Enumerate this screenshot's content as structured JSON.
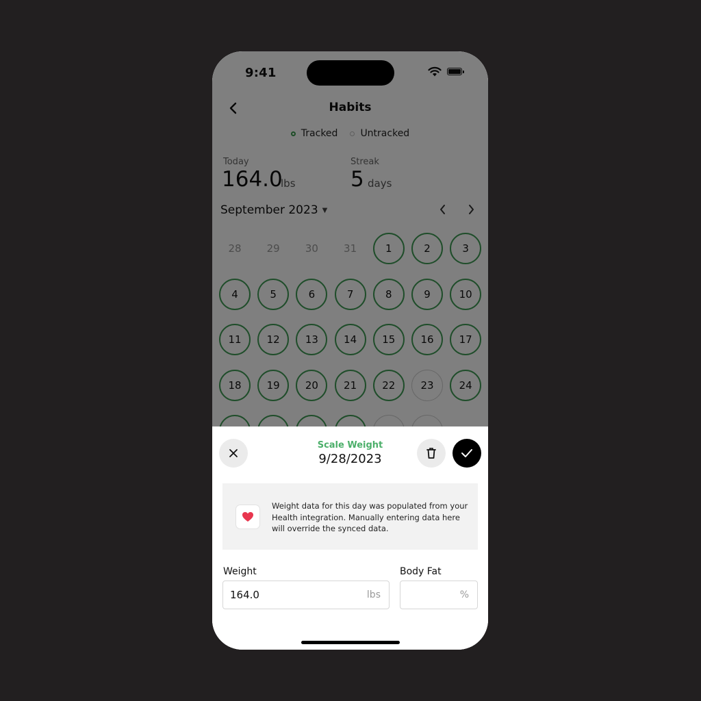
{
  "status_bar": {
    "time": "9:41"
  },
  "header": {
    "title": "Habits"
  },
  "legend": {
    "tracked": "Tracked",
    "untracked": "Untracked"
  },
  "stats": {
    "today": {
      "label": "Today",
      "value": "164.0",
      "unit": "lbs"
    },
    "streak": {
      "label": "Streak",
      "value": "5",
      "unit": "days"
    }
  },
  "calendar": {
    "month": "September 2023",
    "days": [
      {
        "label": "28",
        "state": "outside"
      },
      {
        "label": "29",
        "state": "outside"
      },
      {
        "label": "30",
        "state": "outside"
      },
      {
        "label": "31",
        "state": "outside"
      },
      {
        "label": "1",
        "state": "tracked"
      },
      {
        "label": "2",
        "state": "tracked"
      },
      {
        "label": "3",
        "state": "tracked"
      },
      {
        "label": "4",
        "state": "tracked"
      },
      {
        "label": "5",
        "state": "tracked"
      },
      {
        "label": "6",
        "state": "tracked"
      },
      {
        "label": "7",
        "state": "tracked"
      },
      {
        "label": "8",
        "state": "tracked"
      },
      {
        "label": "9",
        "state": "tracked"
      },
      {
        "label": "10",
        "state": "tracked"
      },
      {
        "label": "11",
        "state": "tracked"
      },
      {
        "label": "12",
        "state": "tracked"
      },
      {
        "label": "13",
        "state": "tracked"
      },
      {
        "label": "14",
        "state": "tracked"
      },
      {
        "label": "15",
        "state": "tracked"
      },
      {
        "label": "16",
        "state": "tracked"
      },
      {
        "label": "17",
        "state": "tracked"
      },
      {
        "label": "18",
        "state": "tracked"
      },
      {
        "label": "19",
        "state": "tracked"
      },
      {
        "label": "20",
        "state": "tracked"
      },
      {
        "label": "21",
        "state": "tracked"
      },
      {
        "label": "22",
        "state": "tracked"
      },
      {
        "label": "23",
        "state": "untracked"
      },
      {
        "label": "24",
        "state": "tracked"
      },
      {
        "label": "",
        "state": "tracked"
      },
      {
        "label": "",
        "state": "tracked"
      },
      {
        "label": "",
        "state": "tracked"
      },
      {
        "label": "",
        "state": "tracked"
      },
      {
        "label": "",
        "state": "untracked"
      },
      {
        "label": "",
        "state": "untracked"
      }
    ]
  },
  "sheet": {
    "subtitle": "Scale Weight",
    "date": "9/28/2023",
    "info": "Weight data for this day was populated from your Health integration. Manually entering data here will override the synced data.",
    "weight": {
      "label": "Weight",
      "value": "164.0",
      "unit": "lbs"
    },
    "body_fat": {
      "label": "Body Fat",
      "value": "",
      "unit": "%"
    }
  },
  "colors": {
    "tracked": "#3f9b55",
    "accent_green": "#4caf6a",
    "background": "#221f20",
    "heart": "#e8364f"
  },
  "icons": {
    "back": "chevron-left-icon",
    "close": "close-icon",
    "delete": "trash-icon",
    "confirm": "check-icon",
    "health": "heart-icon"
  }
}
